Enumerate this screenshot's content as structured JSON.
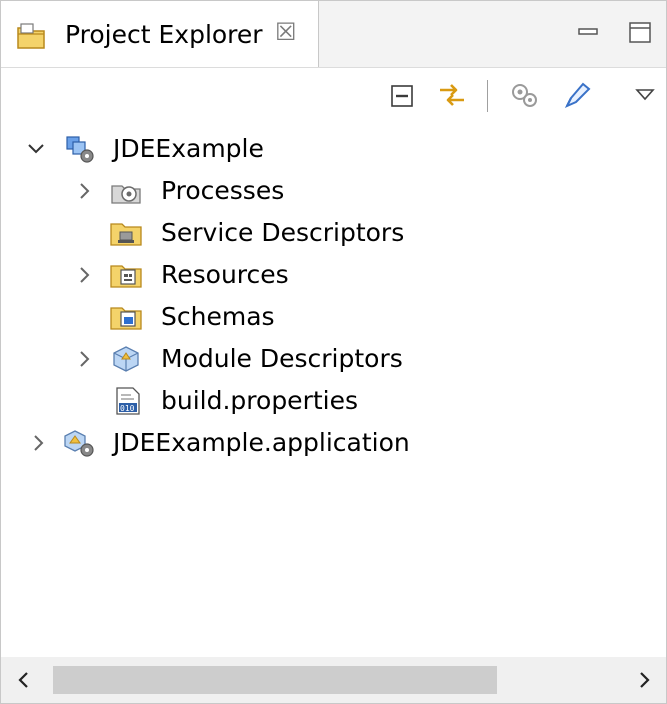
{
  "tab": {
    "title": "Project Explorer",
    "close_glyph": "☒"
  },
  "window_controls": {
    "minimize_icon": "minimize-icon",
    "maximize_icon": "maximize-icon"
  },
  "toolbar": {
    "collapse_all_icon": "collapse-all-icon",
    "link_with_editor_icon": "link-with-editor-icon",
    "filter_icon": "filter-icon",
    "focus_icon": "focus-icon",
    "view_menu_icon": "view-menu-icon"
  },
  "tree": {
    "project": {
      "label": "JDEExample",
      "expanded": true,
      "children": [
        {
          "label": "Processes",
          "icon": "processes-icon",
          "expandable": true
        },
        {
          "label": "Service Descriptors",
          "icon": "service-descriptors-icon",
          "expandable": false
        },
        {
          "label": "Resources",
          "icon": "resources-icon",
          "expandable": true
        },
        {
          "label": "Schemas",
          "icon": "schemas-icon",
          "expandable": false
        },
        {
          "label": "Module Descriptors",
          "icon": "module-descriptors-icon",
          "expandable": true
        },
        {
          "label": "build.properties",
          "icon": "properties-file-icon",
          "expandable": false
        }
      ]
    },
    "application": {
      "label": "JDEExample.application",
      "expanded": false
    }
  },
  "colors": {
    "folder": "#f0c040",
    "folder_dark": "#c8941c",
    "link": "#3a72c8",
    "gear": "#777777"
  }
}
